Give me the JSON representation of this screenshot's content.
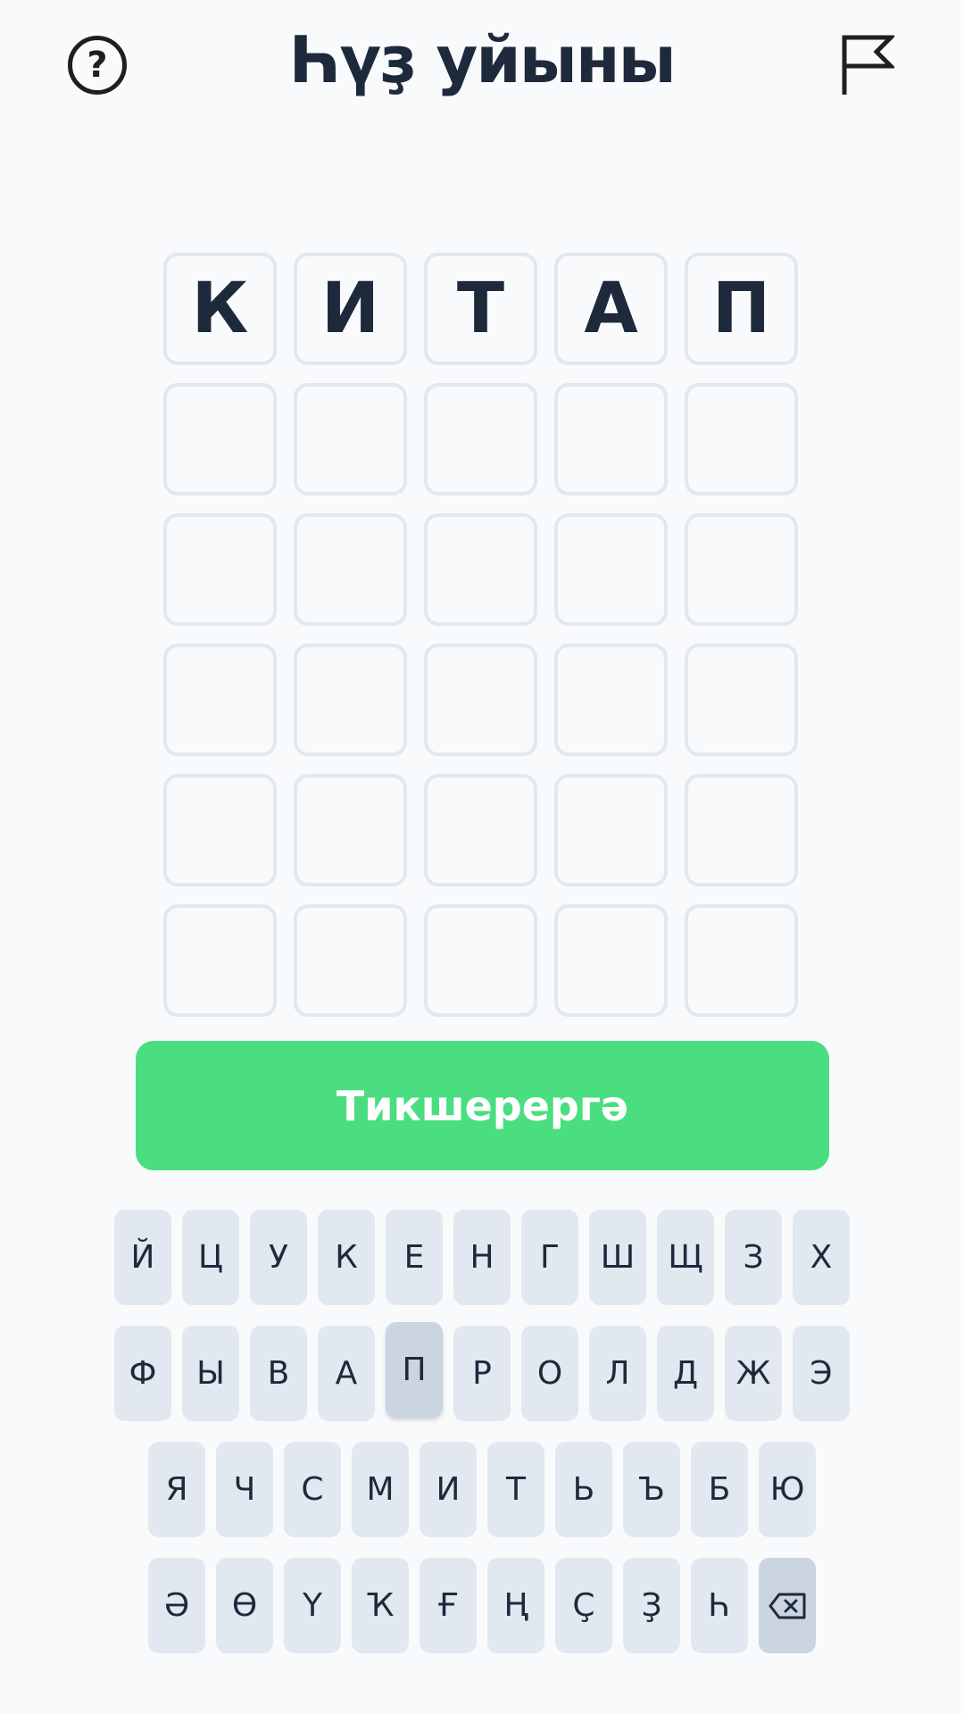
{
  "header": {
    "title": "Һүҙ уйыны",
    "help_icon_glyph": "?",
    "help_icon": "help-circle-icon",
    "flag_icon": "flag-icon"
  },
  "grid": {
    "rows": [
      [
        "К",
        "И",
        "Т",
        "А",
        "П"
      ],
      [
        "",
        "",
        "",
        "",
        ""
      ],
      [
        "",
        "",
        "",
        "",
        ""
      ],
      [
        "",
        "",
        "",
        "",
        ""
      ],
      [
        "",
        "",
        "",
        "",
        ""
      ],
      [
        "",
        "",
        "",
        "",
        ""
      ]
    ]
  },
  "check_button": {
    "label": "Тикшерергә",
    "color": "#4ade80"
  },
  "keyboard": {
    "rows": [
      [
        "Й",
        "Ц",
        "У",
        "К",
        "Е",
        "Н",
        "Г",
        "Ш",
        "Щ",
        "З",
        "Х"
      ],
      [
        "Ф",
        "Ы",
        "В",
        "А",
        "П",
        "Р",
        "О",
        "Л",
        "Д",
        "Ж",
        "Э"
      ],
      [
        "Я",
        "Ч",
        "С",
        "М",
        "И",
        "Т",
        "Ь",
        "Ъ",
        "Б",
        "Ю"
      ],
      [
        "Ә",
        "Ө",
        "Ү",
        "Ҡ",
        "Ғ",
        "Ң",
        "Ҫ",
        "Ҙ",
        "Һ"
      ]
    ],
    "pressed_key": "П",
    "backspace_icon": "backspace-icon"
  }
}
